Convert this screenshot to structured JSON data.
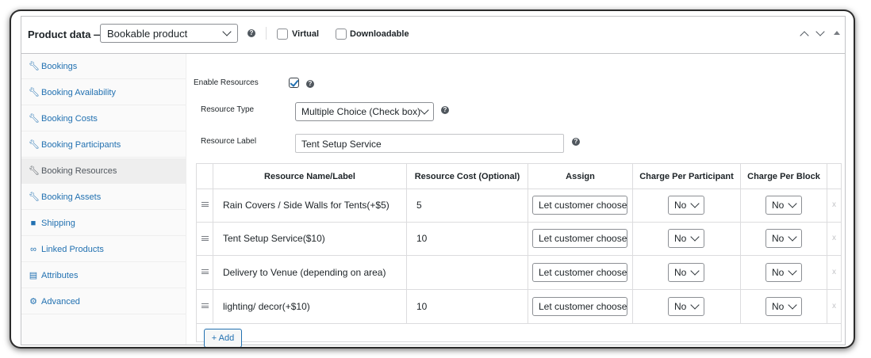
{
  "header": {
    "title": "Product data —",
    "product_type": "Bookable product",
    "virtual_label": "Virtual",
    "downloadable_label": "Downloadable"
  },
  "sidebar": {
    "items": [
      {
        "label": "Bookings",
        "icon": "wrench-icon",
        "active": false
      },
      {
        "label": "Booking Availability",
        "icon": "wrench-icon",
        "active": false
      },
      {
        "label": "Booking Costs",
        "icon": "wrench-icon",
        "active": false
      },
      {
        "label": "Booking Participants",
        "icon": "wrench-icon",
        "active": false
      },
      {
        "label": "Booking Resources",
        "icon": "wrench-icon",
        "active": true
      },
      {
        "label": "Booking Assets",
        "icon": "wrench-icon",
        "active": false
      },
      {
        "label": "Shipping",
        "icon": "truck-icon",
        "active": false
      },
      {
        "label": "Linked Products",
        "icon": "link-icon",
        "active": false
      },
      {
        "label": "Attributes",
        "icon": "list-icon",
        "active": false
      },
      {
        "label": "Advanced",
        "icon": "gear-icon",
        "active": false
      }
    ]
  },
  "form": {
    "enable_resources_label": "Enable Resources",
    "enable_resources_checked": true,
    "resource_type_label": "Resource Type",
    "resource_type_value": "Multiple Choice (Check box)",
    "resource_label_label": "Resource Label",
    "resource_label_value": "Tent Setup Service"
  },
  "table": {
    "headers": [
      "Resource Name/Label",
      "Resource Cost (Optional)",
      "Assign",
      "Charge Per Participant",
      "Charge Per Block"
    ],
    "rows": [
      {
        "name": "Rain Covers / Side Walls for Tents(+$5)",
        "cost": "5",
        "assign": "Let customer choose",
        "per_participant": "No",
        "per_block": "No"
      },
      {
        "name": "Tent Setup Service($10)",
        "cost": "10",
        "assign": "Let customer choose",
        "per_participant": "No",
        "per_block": "No"
      },
      {
        "name": "Delivery to Venue (depending on area)",
        "cost": "",
        "assign": "Let customer choose",
        "per_participant": "No",
        "per_block": "No"
      },
      {
        "name": "lighting/ decor(+$10)",
        "cost": "10",
        "assign": "Let customer choose",
        "per_participant": "No",
        "per_block": "No"
      }
    ],
    "delete_glyph": "x",
    "add_button": "+ Add"
  },
  "colors": {
    "link": "#2271b1",
    "border": "#c3c4c7",
    "sidebar_bg": "#fafafa",
    "active_tab_bg": "#eeeeee"
  }
}
